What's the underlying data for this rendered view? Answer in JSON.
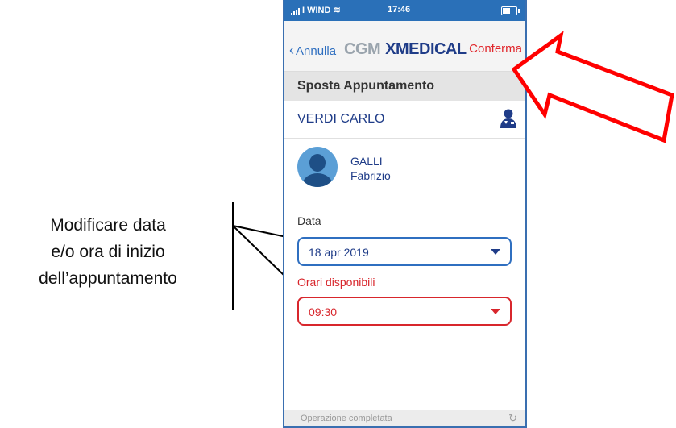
{
  "status_bar": {
    "carrier": "I WIND",
    "time": "17:46"
  },
  "nav": {
    "back_label": "Annulla",
    "logo_cgm": "CGM",
    "logo_xmedical": "XMEDICAL",
    "confirm_label": "Conferma"
  },
  "section_title": "Sposta Appuntamento",
  "patient": {
    "name": "VERDI CARLO",
    "icon": "doctor-user-icon"
  },
  "doctor": {
    "last_name": "GALLI",
    "first_name": "Fabrizio"
  },
  "date_field": {
    "label": "Data",
    "value": "18 apr 2019"
  },
  "hours_field": {
    "label": "Orari disponibili",
    "value": "09:30"
  },
  "toast": {
    "message": "Operazione completata",
    "icon": "refresh-icon"
  },
  "annotation": {
    "line1": "Modificare data",
    "line2": "e/o ora di inizio",
    "line3": "dell’appuntamento"
  },
  "colors": {
    "accent_blue": "#2f6fc0",
    "navy": "#1f3c88",
    "error_red": "#d8262c",
    "callout_red": "#ff0000"
  }
}
